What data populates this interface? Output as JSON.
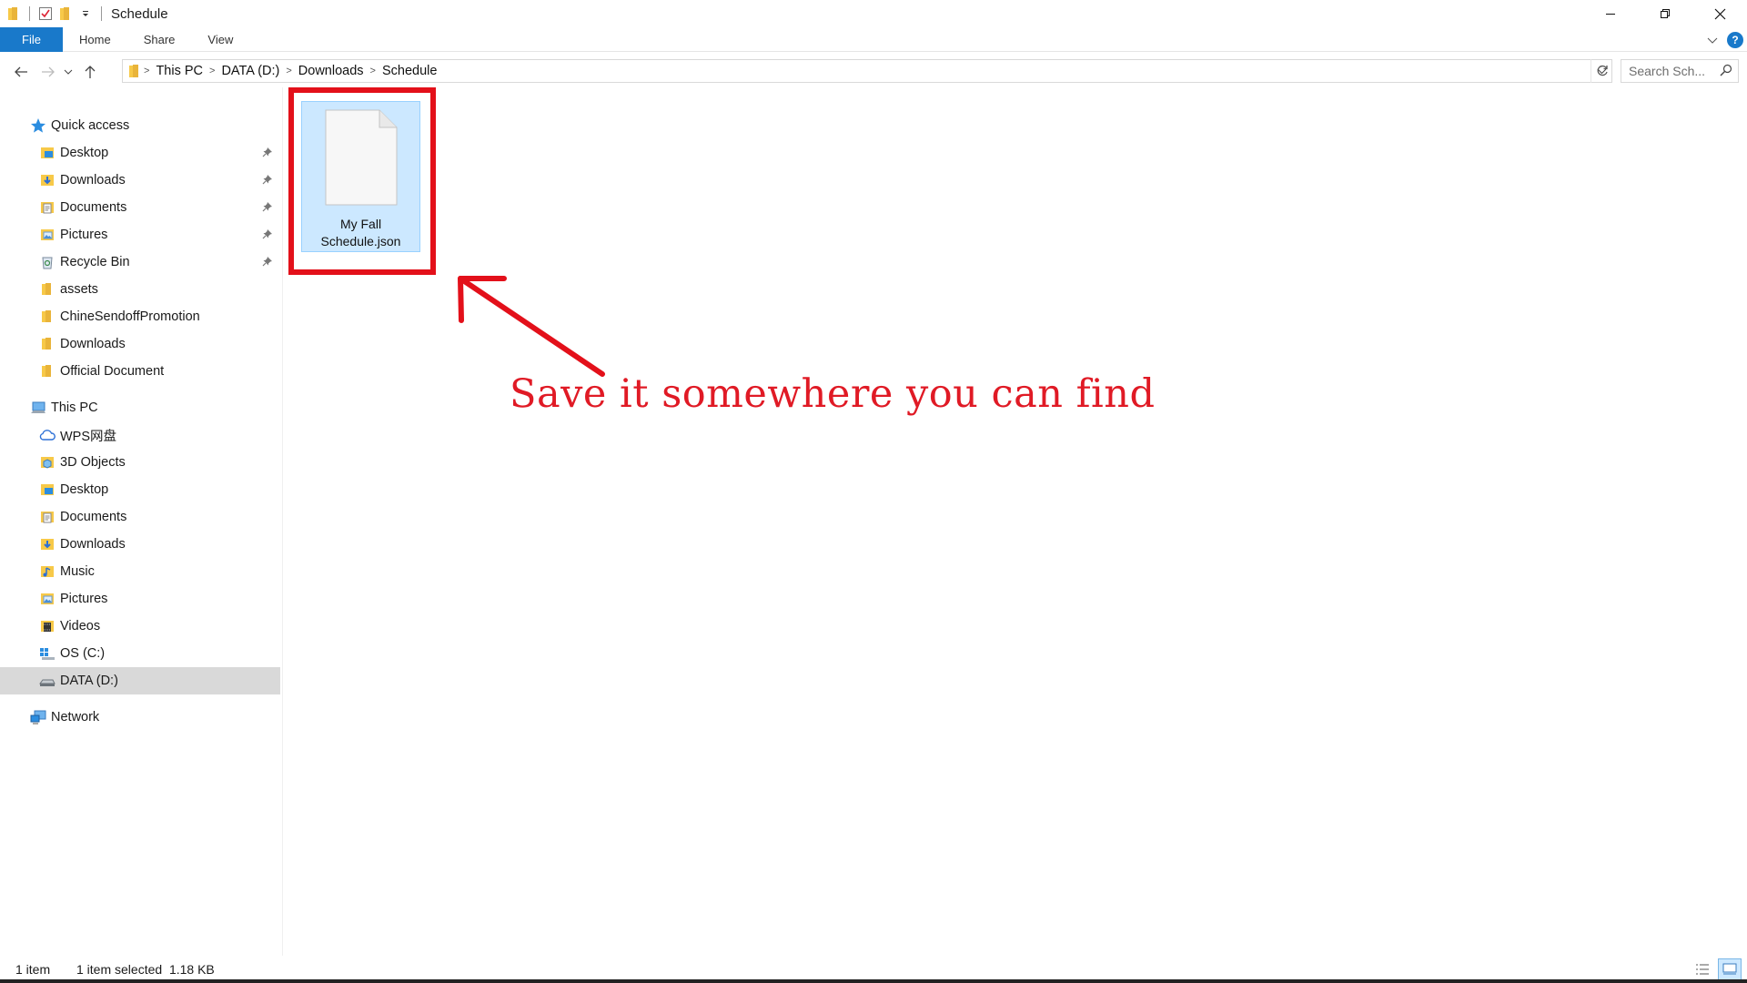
{
  "window": {
    "title": "Schedule"
  },
  "ribbon": {
    "tabs": [
      "File",
      "Home",
      "Share",
      "View"
    ],
    "help_label": "?"
  },
  "address": {
    "crumbs": [
      "This PC",
      "DATA (D:)",
      "Downloads",
      "Schedule"
    ],
    "search_placeholder": "Search Sch..."
  },
  "sidebar": {
    "quick_access": {
      "label": "Quick access",
      "items": [
        {
          "label": "Desktop",
          "icon": "desktop-folder-icon",
          "pinned": true
        },
        {
          "label": "Downloads",
          "icon": "downloads-folder-icon",
          "pinned": true
        },
        {
          "label": "Documents",
          "icon": "documents-folder-icon",
          "pinned": true
        },
        {
          "label": "Pictures",
          "icon": "pictures-folder-icon",
          "pinned": true
        },
        {
          "label": "Recycle Bin",
          "icon": "recycle-bin-icon",
          "pinned": true
        },
        {
          "label": "assets",
          "icon": "folder-icon",
          "pinned": false
        },
        {
          "label": "ChineSendoffPromotion",
          "icon": "folder-icon",
          "pinned": false
        },
        {
          "label": "Downloads",
          "icon": "folder-icon",
          "pinned": false
        },
        {
          "label": "Official Document",
          "icon": "folder-icon",
          "pinned": false
        }
      ]
    },
    "this_pc": {
      "label": "This PC",
      "items": [
        {
          "label": "WPS网盘",
          "icon": "cloud-icon"
        },
        {
          "label": "3D Objects",
          "icon": "3d-objects-folder-icon"
        },
        {
          "label": "Desktop",
          "icon": "desktop-folder-icon"
        },
        {
          "label": "Documents",
          "icon": "documents-folder-icon"
        },
        {
          "label": "Downloads",
          "icon": "downloads-folder-icon"
        },
        {
          "label": "Music",
          "icon": "music-folder-icon"
        },
        {
          "label": "Pictures",
          "icon": "pictures-folder-icon"
        },
        {
          "label": "Videos",
          "icon": "videos-folder-icon"
        },
        {
          "label": "OS (C:)",
          "icon": "windows-drive-icon"
        },
        {
          "label": "DATA (D:)",
          "icon": "drive-icon",
          "selected": true
        }
      ]
    },
    "network": {
      "label": "Network"
    }
  },
  "content": {
    "files": [
      {
        "name": "My Fall Schedule.json",
        "name_line1": "My Fall",
        "name_line2": "Schedule.json",
        "selected": true
      }
    ],
    "annotation": "Save it somewhere you can find"
  },
  "status": {
    "item_count": "1 item",
    "selection": "1 item selected  1.18 KB"
  },
  "colors": {
    "accent": "#1979ca",
    "annotation_red": "#e01a25",
    "selection_bg": "#cce8ff",
    "folder_yellow": "#f7c948"
  }
}
